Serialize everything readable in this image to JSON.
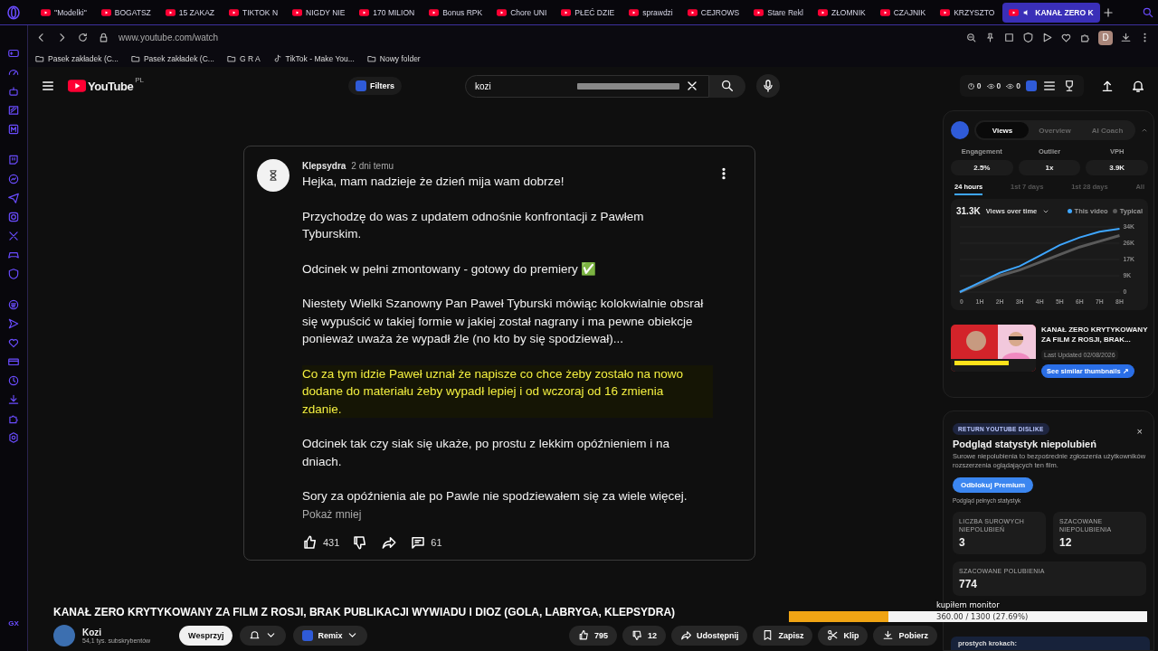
{
  "browser": {
    "tabs": [
      {
        "label": "''Modelki''",
        "selected": false,
        "playing_audio": false
      },
      {
        "label": "BOGATSZ",
        "selected": false,
        "playing_audio": false
      },
      {
        "label": "15 ZAKAZ",
        "selected": false,
        "playing_audio": false
      },
      {
        "label": "TIKTOK N",
        "selected": false,
        "playing_audio": false
      },
      {
        "label": "NIGDY NIE",
        "selected": false,
        "playing_audio": false
      },
      {
        "label": "170 MILION",
        "selected": false,
        "playing_audio": false
      },
      {
        "label": "Bonus RPK",
        "selected": false,
        "playing_audio": false
      },
      {
        "label": "Chore UNI",
        "selected": false,
        "playing_audio": false
      },
      {
        "label": "PŁEĆ DZIE",
        "selected": false,
        "playing_audio": false
      },
      {
        "label": "sprawdzi",
        "selected": false,
        "playing_audio": false
      },
      {
        "label": "CEJROWS",
        "selected": false,
        "playing_audio": false
      },
      {
        "label": "Stare Rekl",
        "selected": false,
        "playing_audio": false
      },
      {
        "label": "ZŁOMNIK",
        "selected": false,
        "playing_audio": false
      },
      {
        "label": "CZAJNIK",
        "selected": false,
        "playing_audio": false
      },
      {
        "label": "KRZYSZTO",
        "selected": false,
        "playing_audio": false
      },
      {
        "label": "KANAŁ ZERO K",
        "selected": true,
        "playing_audio": true
      }
    ],
    "address": "www.youtube.com/watch",
    "profile_initial": "D",
    "bookmarks": [
      {
        "kind": "folder",
        "label": "Pasek zakładek (C..."
      },
      {
        "kind": "folder",
        "label": "Pasek zakładek (C..."
      },
      {
        "kind": "folder",
        "label": "G R A"
      },
      {
        "kind": "tiktok",
        "label": "TikTok - Make You..."
      },
      {
        "kind": "folder",
        "label": "Nowy folder"
      }
    ],
    "sidebar_label": "GX"
  },
  "masthead": {
    "logo": "YouTube",
    "region": "PL",
    "filters": "Filters",
    "search_value": "kozi",
    "counters": [
      "0",
      "0",
      "0"
    ]
  },
  "comment": {
    "author": "Klepsydra",
    "time": "2 dni temu",
    "paragraphs": [
      {
        "text": "Hejka, mam nadzieje że dzień mija wam dobrze!",
        "highlighted": false
      },
      {
        "text": "Przychodzę do was z updatem odnośnie konfrontacji z Pawłem Tyburskim.",
        "highlighted": false
      },
      {
        "text": "Odcinek w pełni zmontowany - gotowy do premiery ✅",
        "highlighted": false
      },
      {
        "text": "Niestety Wielki Szanowny Pan Paweł Tyburski mówiąc kolokwialnie obsrał się wypuścić w takiej formie w jakiej został nagrany i ma pewne obiekcje ponieważ uważa że wypadł źle (no kto by się spodziewał)...",
        "highlighted": false
      },
      {
        "text": "Co za tym idzie Paweł uznał że napisze co chce żeby zostało na nowo dodane do materiału żeby wypadł lepiej i od wczoraj od 16 zmienia zdanie.",
        "highlighted": true
      },
      {
        "text": "Odcinek tak czy siak się ukaże, po prostu z lekkim opóźnieniem i na dniach.",
        "highlighted": false
      },
      {
        "text": "Sory za opóźnienia ale po Pawle nie spodziewałem się za wiele więcej.",
        "highlighted": false
      }
    ],
    "show_less": "Pokaż mniej",
    "likes": "431",
    "replies": "61"
  },
  "video": {
    "title": "KANAŁ ZERO KRYTYKOWANY ZA FILM Z ROSJI, BRAK PUBLIKACJI WYWIADU I DIOZ (GOLA, LABRYGA, KLEPSYDRA)",
    "channel": "Kozi",
    "subscribers": "54,1 tys. subskrybentów",
    "support": "Wesprzyj",
    "remix": "Remix",
    "likes": "795",
    "dislikes": "12",
    "share": "Udostępnij",
    "save": "Zapisz",
    "clip": "Klip",
    "download": "Pobierz"
  },
  "analytics": {
    "tabs": [
      {
        "label": "Views",
        "selected": true
      },
      {
        "label": "Overview",
        "selected": false
      },
      {
        "label": "AI Coach",
        "selected": false
      }
    ],
    "metrics": [
      {
        "label": "Engagement",
        "value": "2.5%"
      },
      {
        "label": "Outlier",
        "value": "1x"
      },
      {
        "label": "VPH",
        "value": "3.9K"
      }
    ],
    "periods": [
      {
        "label": "24 hours",
        "selected": true
      },
      {
        "label": "1st 7 days",
        "selected": false
      },
      {
        "label": "1st 28 days",
        "selected": false
      },
      {
        "label": "All",
        "selected": false
      }
    ],
    "total": "31.3K",
    "metric_picker": "Views over time",
    "chart_data": {
      "type": "line",
      "categories": [
        "0",
        "1H",
        "2H",
        "3H",
        "4H",
        "5H",
        "6H",
        "7H",
        "8H"
      ],
      "series": [
        {
          "name": "This video",
          "color": "#3ea6ff",
          "values": [
            0,
            5000,
            10000,
            13500,
            19000,
            24500,
            28500,
            31500,
            33000
          ]
        },
        {
          "name": "Typical",
          "color": "#5a5a5a",
          "values": [
            0,
            4200,
            8500,
            11500,
            15500,
            19500,
            23500,
            26500,
            29500
          ]
        }
      ],
      "ylim": [
        0,
        34000
      ],
      "yticks": [
        {
          "value": 0,
          "label": "0"
        },
        {
          "value": 8500,
          "label": "9K"
        },
        {
          "value": 17000,
          "label": "17K"
        },
        {
          "value": 25500,
          "label": "26K"
        },
        {
          "value": 34000,
          "label": "34K"
        }
      ]
    },
    "thumbnail": {
      "title": "KANAŁ ZERO KRYTYKOWANY ZA FILM Z ROSJI, BRAK...",
      "updated": "Last Updated 02/08/2026",
      "button": "See similar thumbnails ↗"
    }
  },
  "dislikes": {
    "badge": "RETURN YOUTUBE DISLIKE",
    "close": "×",
    "heading": "Podgląd statystyk niepolubień",
    "description": "Surowe niepolubienia to bezpośrednie zgłoszenia użytkowników rozszerzenia oglądających ten film.",
    "button": "Odblokuj Premium",
    "note": "Podgląd pełnych statystyk",
    "stats": [
      {
        "label": "LICZBA SUROWYCH NIEPOLUBIEŃ",
        "value": "3"
      },
      {
        "label": "SZACOWANE NIEPOLUBIENIA",
        "value": "12"
      },
      {
        "label": "SZACOWANE POLUBIENIA",
        "value": "774"
      }
    ],
    "tip": "prostych krokach:"
  },
  "stream_goal": {
    "label": "kupiłem monitor",
    "level": 0.2769,
    "reading": "360.00 / 1300 (27.69%)"
  }
}
